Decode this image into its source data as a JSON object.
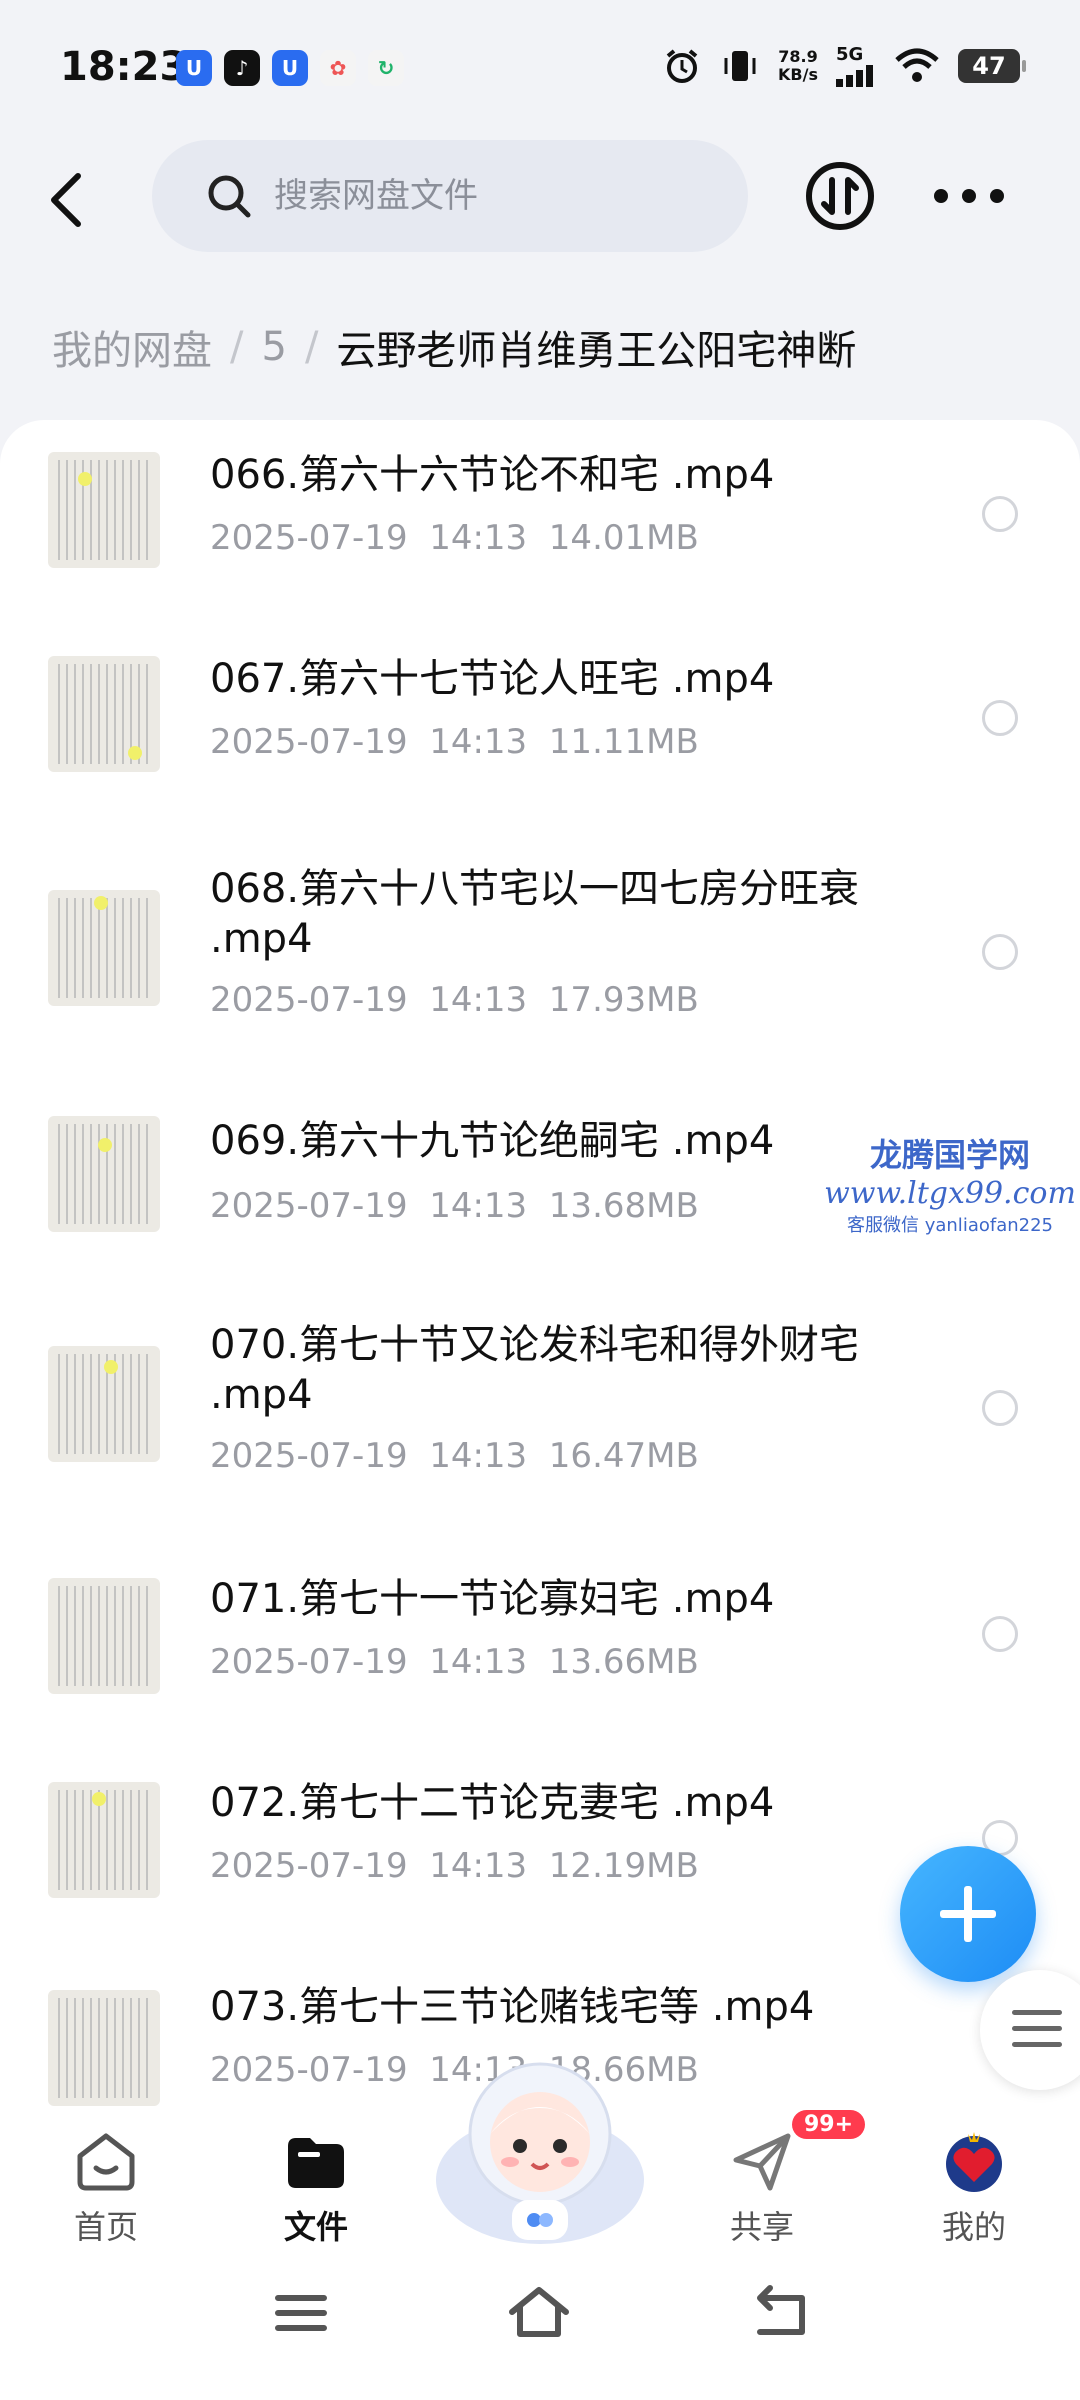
{
  "status_bar": {
    "time": "18:23",
    "net_speed_value": "78.9",
    "net_speed_unit": "KB/s",
    "network": "5G",
    "battery": "47"
  },
  "header": {
    "search_placeholder": "搜索网盘文件"
  },
  "breadcrumb": {
    "root": "我的网盘",
    "level1": "5",
    "current": "云野老师肖维勇王公阳宅神断"
  },
  "files": [
    {
      "name": "066.第六十六节论不和宅 .mp4",
      "meta": "2025-07-19  14:13  14.01MB"
    },
    {
      "name": "067.第六十七节论人旺宅 .mp4",
      "meta": "2025-07-19  14:13  11.11MB"
    },
    {
      "name": "068.第六十八节宅以一四七房分旺衰 .mp4",
      "meta": "2025-07-19  14:13  17.93MB"
    },
    {
      "name": "069.第六十九节论绝嗣宅 .mp4",
      "meta": "2025-07-19  14:13  13.68MB"
    },
    {
      "name": "070.第七十节又论发科宅和得外财宅 .mp4",
      "meta": "2025-07-19  14:13  16.47MB"
    },
    {
      "name": "071.第七十一节论寡妇宅 .mp4",
      "meta": "2025-07-19  14:13  13.66MB"
    },
    {
      "name": "072.第七十二节论克妻宅 .mp4",
      "meta": "2025-07-19  14:13  12.19MB"
    },
    {
      "name": "073.第七十三节论赌钱宅等 .mp4",
      "meta": "2025-07-19  14:13  18.66MB"
    }
  ],
  "watermark": {
    "line1": "龙腾国学网",
    "line2": "www.ltgx99.com",
    "line3": "客服微信 yanliaofan225"
  },
  "bottom_nav": {
    "home": "首页",
    "files": "文件",
    "share": "共享",
    "share_badge": "99+",
    "mine": "我的"
  },
  "colors": {
    "accent": "#1d8cf5",
    "badge": "#ff3b4e",
    "muted_text": "#9a9ca3"
  }
}
